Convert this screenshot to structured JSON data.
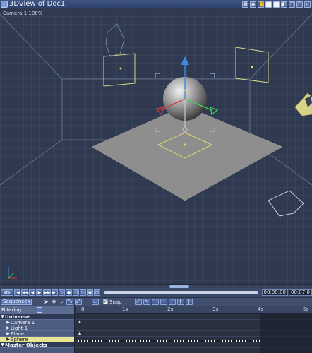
{
  "titlebar": {
    "title": "3DView of Doc1"
  },
  "viewport": {
    "camera_label": "Camera 1 100%"
  },
  "transport": {
    "time_left": "00:00:00",
    "time_right": "00:07:0",
    "mode_label": "ate"
  },
  "sequencer": {
    "mode": "Sequencer",
    "snap_label": "Snap",
    "snap_checked": true,
    "filter_label": "Filtering",
    "ruler_labels": [
      "0",
      "1s",
      "2s",
      "3s",
      "4s",
      "5s"
    ]
  },
  "tree": {
    "universe": "Universe",
    "items": [
      "Camera 1",
      "Light 1",
      "Plane",
      "Sphere"
    ],
    "selected": "Sphere",
    "master": "Master Objects"
  },
  "colors": {
    "background": "#2f3a50",
    "grid": "#4d5a78",
    "plane": "#8e8e8e",
    "selection": "#e8e496",
    "axis_y": "#3d8be0",
    "axis_x": "#d23b3b",
    "axis_z": "#3bd25a"
  },
  "icons": [
    "app-icon",
    "play-icon",
    "rewind-icon",
    "forward-icon",
    "arrow-tool-icon",
    "zoom-icon",
    "key-icon"
  ]
}
